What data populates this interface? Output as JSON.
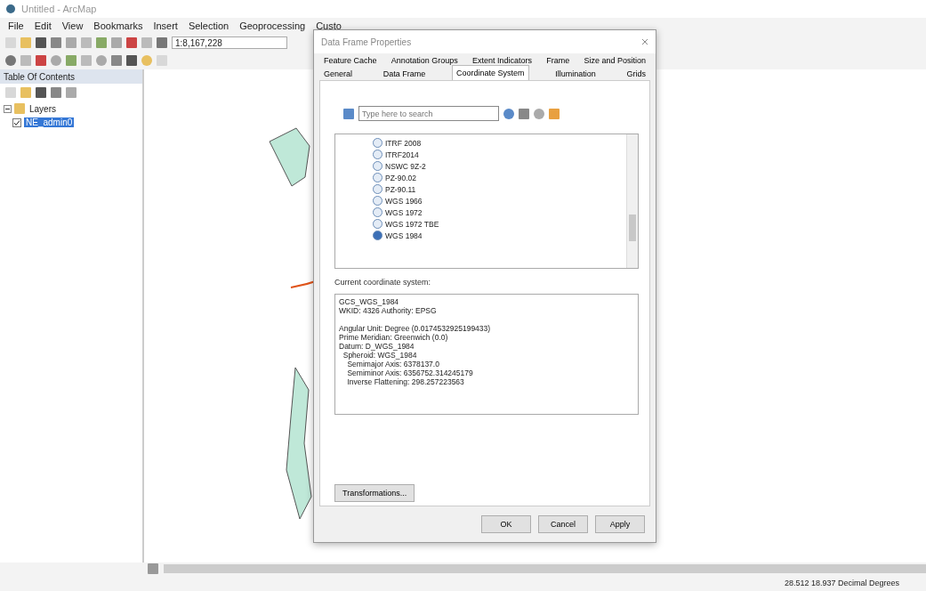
{
  "window": {
    "title": "Untitled - ArcMap"
  },
  "menu": [
    "File",
    "Edit",
    "View",
    "Bookmarks",
    "Insert",
    "Selection",
    "Geoprocessing",
    "Custo"
  ],
  "scale": {
    "value": "1:8,167,228"
  },
  "toc": {
    "title": "Table Of Contents",
    "layers": {
      "label": "Layers",
      "expanded": true,
      "children": [
        {
          "label": "NE_admin0",
          "selected": true,
          "checked": true
        }
      ]
    }
  },
  "dialog": {
    "title": "Data Frame Properties",
    "tab_rows": [
      [
        {
          "label": "Feature Cache",
          "selected": false
        },
        {
          "label": "Annotation Groups",
          "selected": false
        },
        {
          "label": "Extent Indicators",
          "selected": false
        },
        {
          "label": "Frame",
          "selected": false
        },
        {
          "label": "Size and Position",
          "selected": false
        }
      ],
      [
        {
          "label": "General",
          "selected": false
        },
        {
          "label": "Data Frame",
          "selected": false
        },
        {
          "label": "Coordinate System",
          "selected": true
        },
        {
          "label": "Illumination",
          "selected": false
        },
        {
          "label": "Grids",
          "selected": false
        }
      ]
    ],
    "search": {
      "placeholder": "Type here to search"
    },
    "systems": [
      {
        "label": "ITRF 2008",
        "selected": false
      },
      {
        "label": "ITRF2014",
        "selected": false
      },
      {
        "label": "NSWC 9Z-2",
        "selected": false
      },
      {
        "label": "PZ-90.02",
        "selected": false
      },
      {
        "label": "PZ-90.11",
        "selected": false
      },
      {
        "label": "WGS 1966",
        "selected": false
      },
      {
        "label": "WGS 1972",
        "selected": false
      },
      {
        "label": "WGS 1972 TBE",
        "selected": false
      },
      {
        "label": "WGS 1984",
        "selected": true
      }
    ],
    "current_label": "Current coordinate system:",
    "current_header": [
      "GCS_WGS_1984",
      "WKID: 4326 Authority: EPSG"
    ],
    "current": [
      "Angular Unit: Degree (0.0174532925199433)",
      "Prime Meridian: Greenwich (0.0)",
      "Datum: D_WGS_1984",
      "  Spheroid: WGS_1984",
      "    Semimajor Axis: 6378137.0",
      "    Semiminor Axis: 6356752.314245179",
      "    Inverse Flattening: 298.257223563"
    ],
    "transform_button": "Transformations...",
    "buttons": [
      "OK",
      "Cancel",
      "Apply"
    ]
  },
  "status_bar": {
    "coordinates": "28.512 18.937 Decimal Degrees"
  }
}
